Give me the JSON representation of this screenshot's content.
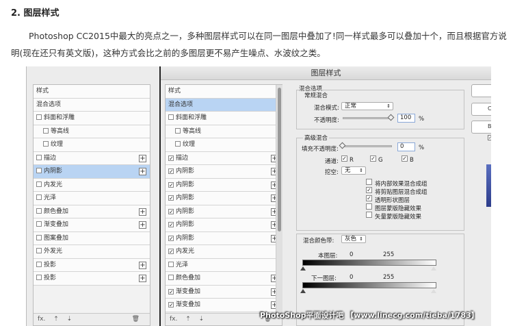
{
  "article": {
    "heading": "2. 图层样式",
    "paragraph": "Photoshop CC2015中最大的亮点之一，多种图层样式可以在同一图层中叠加了!同一样式最多可以叠加十个，而且根据官方说明(现在还只有英文版)，这种方式会比之前的多图层更不易产生噪点、水波纹之类。"
  },
  "dialog": {
    "title": "图层样式",
    "left_panel": [
      {
        "label": "样式"
      },
      {
        "label": "混合选项"
      },
      {
        "label": "斜面和浮雕",
        "checkbox": false
      },
      {
        "label": "等高线",
        "checkbox": false,
        "indent": true
      },
      {
        "label": "纹理",
        "checkbox": false,
        "indent": true
      },
      {
        "label": "描边",
        "checkbox": false,
        "plus": "+"
      },
      {
        "label": "内阴影",
        "checkbox": false,
        "plus": "+",
        "selected": true
      },
      {
        "label": "内发光",
        "checkbox": false
      },
      {
        "label": "光泽",
        "checkbox": false
      },
      {
        "label": "颜色叠加",
        "checkbox": false,
        "plus": "+"
      },
      {
        "label": "渐变叠加",
        "checkbox": false,
        "plus": "+"
      },
      {
        "label": "图案叠加",
        "checkbox": false
      },
      {
        "label": "外发光",
        "checkbox": false
      },
      {
        "label": "投影",
        "checkbox": false,
        "plus": "+"
      },
      {
        "label": "投影",
        "checkbox": false,
        "plus": "+"
      }
    ],
    "mid_panel": [
      {
        "label": "样式"
      },
      {
        "label": "混合选项",
        "selected": true
      },
      {
        "label": "斜面和浮雕",
        "checkbox": false
      },
      {
        "label": "等高线",
        "checkbox": false,
        "indent": true
      },
      {
        "label": "纹理",
        "checkbox": false,
        "indent": true
      },
      {
        "label": "描边",
        "checkbox": true,
        "plus": "+"
      },
      {
        "label": "内阴影",
        "checkbox": true,
        "plus": "+"
      },
      {
        "label": "内阴影",
        "checkbox": true,
        "plus": "+"
      },
      {
        "label": "内阴影",
        "checkbox": true,
        "plus": "+"
      },
      {
        "label": "内阴影",
        "checkbox": true,
        "plus": "+"
      },
      {
        "label": "内阴影",
        "checkbox": true,
        "plus": "+"
      },
      {
        "label": "内阴影",
        "checkbox": true,
        "plus": "+"
      },
      {
        "label": "内发光",
        "checkbox": true
      },
      {
        "label": "光泽",
        "checkbox": false
      },
      {
        "label": "颜色叠加",
        "checkbox": false,
        "plus": "+"
      },
      {
        "label": "渐变叠加",
        "checkbox": true,
        "plus": "+"
      },
      {
        "label": "渐变叠加",
        "checkbox": true,
        "plus": "+"
      }
    ],
    "footer": {
      "fx": "fx.",
      "up": "⇡",
      "down": "⇣",
      "trash": "🗑"
    },
    "options": {
      "section_title": "混合选项",
      "general_title": "常规混合",
      "blend_mode_label": "混合模式:",
      "blend_mode_value": "正常",
      "opacity_label": "不透明度:",
      "opacity_value": "100",
      "opacity_unit": "%",
      "advanced_title": "高级混合",
      "fill_opacity_label": "填充不透明度:",
      "fill_opacity_value": "0",
      "fill_opacity_unit": "%",
      "channels_label": "通道:",
      "channel_r": "R",
      "channel_g": "G",
      "channel_b": "B",
      "knockout_label": "挖空:",
      "knockout_value": "无",
      "checks": [
        {
          "label": "将内部效果混合成组",
          "checked": false
        },
        {
          "label": "将剪贴图层混合成组",
          "checked": true
        },
        {
          "label": "透明形状图层",
          "checked": true
        },
        {
          "label": "图层蒙版隐藏效果",
          "checked": false
        },
        {
          "label": "矢量蒙版隐藏效果",
          "checked": false
        }
      ],
      "blend_if_label": "混合颜色带:",
      "blend_if_value": "灰色",
      "this_layer_label": "本图层:",
      "this_layer_min": "0",
      "this_layer_max": "255",
      "under_layer_label": "下一图层:",
      "under_layer_min": "0",
      "under_layer_max": "255"
    },
    "right_edge": {
      "text_c": "C",
      "text_b": "B"
    }
  },
  "watermark": "PhotoShop平面设计吧 【www.linecg.com/tieba/1783】"
}
